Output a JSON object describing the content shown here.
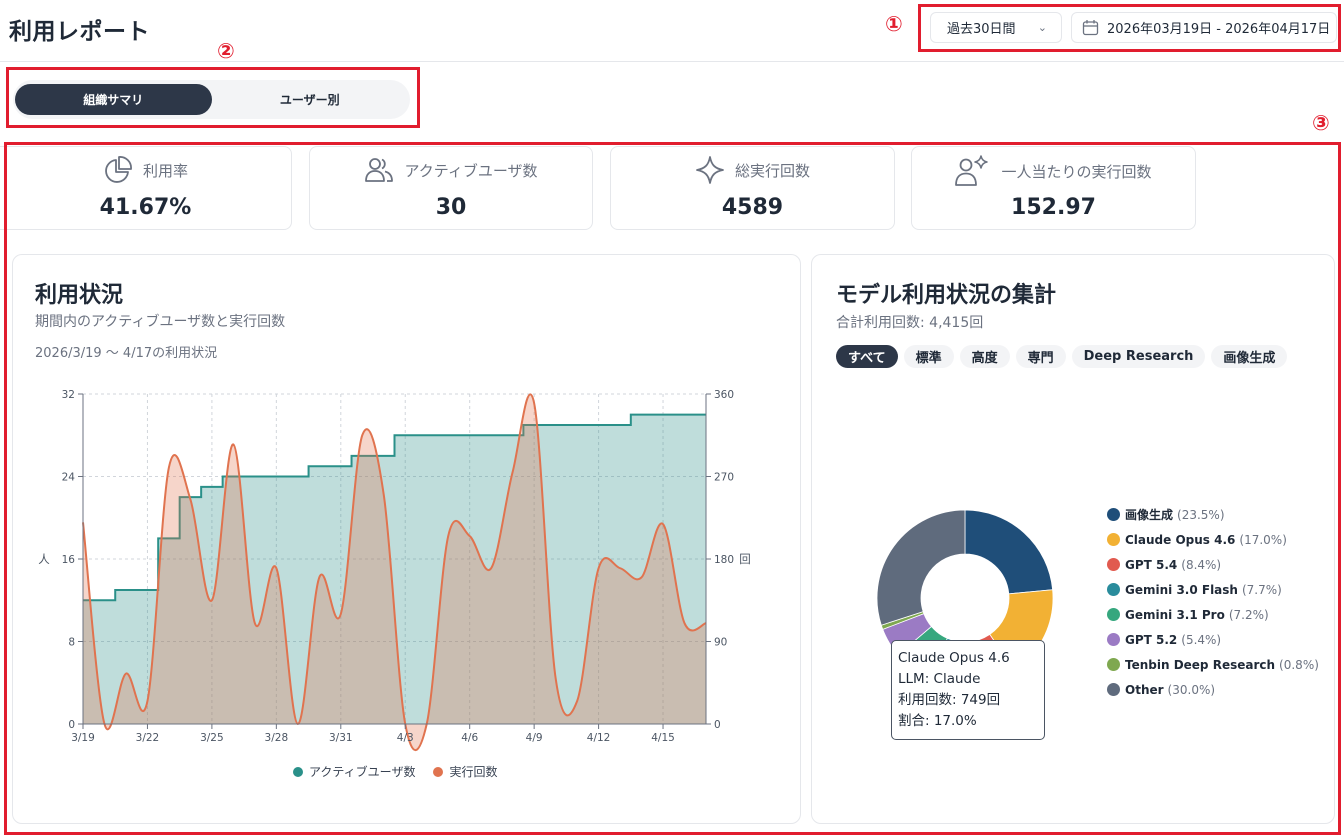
{
  "header": {
    "title": "利用レポート",
    "period_select": "過去30日間",
    "date_range": "2026年03月19日 - 2026年04月17日"
  },
  "tabs": [
    {
      "label": "組織サマリ",
      "active": true
    },
    {
      "label": "ユーザー別",
      "active": false
    }
  ],
  "markers": [
    "①",
    "②",
    "③"
  ],
  "kpis": [
    {
      "label": "利用率",
      "value": "41.67%",
      "icon": "pie-chart-icon"
    },
    {
      "label": "アクティブユーザ数",
      "value": "30",
      "icon": "users-icon"
    },
    {
      "label": "総実行回数",
      "value": "4589",
      "icon": "sparkle-icon"
    },
    {
      "label": "一人当たりの実行回数",
      "value": "152.97",
      "icon": "user-sparkle-icon"
    }
  ],
  "usage_panel": {
    "title": "利用状況",
    "subtitle": "期間内のアクティブユーザ数と実行回数",
    "note": "2026/3/19 〜 4/17の利用状況"
  },
  "model_panel": {
    "title": "モデル利用状況の集計",
    "subtitle": "合計利用回数: 4,415回",
    "filters": [
      {
        "label": "すべて",
        "active": true
      },
      {
        "label": "標準",
        "active": false
      },
      {
        "label": "高度",
        "active": false
      },
      {
        "label": "専門",
        "active": false
      },
      {
        "label": "Deep Research",
        "active": false
      },
      {
        "label": "画像生成",
        "active": false
      }
    ],
    "tooltip": {
      "line1": "Claude Opus 4.6",
      "line2": "LLM: Claude",
      "line3": "利用回数: 749回",
      "line4": "割合: 17.0%"
    }
  },
  "colors": {
    "active_users": "#2a9089",
    "runs": "#e0734f",
    "highlight": "#e11d2e"
  },
  "chart_data": [
    {
      "type": "area",
      "x": [
        "3/19",
        "3/20",
        "3/21",
        "3/22",
        "3/23",
        "3/24",
        "3/25",
        "3/26",
        "3/27",
        "3/28",
        "3/29",
        "3/30",
        "3/31",
        "4/1",
        "4/2",
        "4/3",
        "4/4",
        "4/5",
        "4/6",
        "4/7",
        "4/8",
        "4/9",
        "4/10",
        "4/11",
        "4/12",
        "4/13",
        "4/14",
        "4/15",
        "4/16",
        "4/17"
      ],
      "x_ticks": [
        "3/19",
        "3/22",
        "3/25",
        "3/28",
        "3/31",
        "4/3",
        "4/6",
        "4/9",
        "4/12",
        "4/15"
      ],
      "ylabel_left": "人",
      "ylabel_right": "回",
      "y_left_ticks": [
        0,
        8,
        16,
        24,
        32
      ],
      "y_right_ticks": [
        0,
        90,
        180,
        270,
        360
      ],
      "ylim_left": [
        0,
        32
      ],
      "ylim_right": [
        0,
        360
      ],
      "legend": "bottom",
      "grid": true,
      "series": [
        {
          "name": "アクティブユーザ数",
          "axis": "left",
          "values": [
            12,
            12,
            13,
            13,
            18,
            22,
            23,
            24,
            24,
            24,
            24,
            25,
            25,
            26,
            26,
            28,
            28,
            28,
            28,
            28,
            28,
            29,
            29,
            29,
            29,
            29,
            30,
            30,
            30,
            30
          ]
        },
        {
          "name": "実行回数",
          "axis": "right",
          "values": [
            220,
            0,
            55,
            25,
            280,
            245,
            135,
            305,
            110,
            170,
            0,
            160,
            120,
            315,
            250,
            0,
            0,
            205,
            205,
            170,
            275,
            350,
            50,
            25,
            170,
            170,
            160,
            218,
            110,
            110
          ]
        }
      ]
    },
    {
      "type": "pie",
      "categories": [
        "画像生成",
        "Claude Opus 4.6",
        "GPT 5.4",
        "Gemini 3.0 Flash",
        "Gemini 3.1 Pro",
        "GPT 5.2",
        "Tenbin Deep Research",
        "Other"
      ],
      "values": [
        23.5,
        17.0,
        8.4,
        7.7,
        7.2,
        5.4,
        0.8,
        30.0
      ],
      "labels": [
        "(23.5%)",
        "(17.0%)",
        "(8.4%)",
        "(7.7%)",
        "(7.2%)",
        "(5.4%)",
        "(0.8%)",
        "(30.0%)"
      ],
      "colors": [
        "#1f4e79",
        "#f2b134",
        "#e15a4f",
        "#2a8c9c",
        "#36a77e",
        "#9b7bc4",
        "#7fa850",
        "#5f6b7d"
      ],
      "legend": "right"
    }
  ]
}
